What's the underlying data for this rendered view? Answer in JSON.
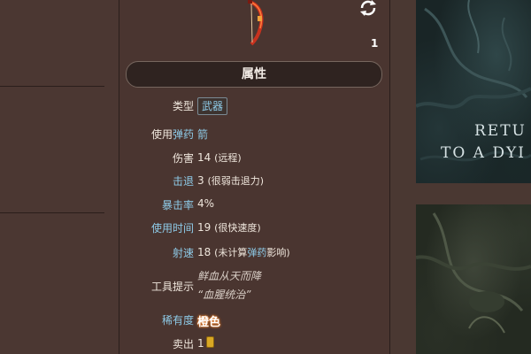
{
  "item": {
    "stack_count": "1",
    "section_title": "属性"
  },
  "stats": {
    "type_label": "类型",
    "type_value": "武器",
    "ammo_label_a": "使用",
    "ammo_label_b": "弹药",
    "ammo_value": "箭",
    "damage_label": "伤害",
    "damage_value": "14",
    "damage_note": "(远程)",
    "knockback_label": "击退",
    "knockback_value": "3",
    "knockback_note": "(很弱击退力)",
    "crit_label": "暴击率",
    "crit_value": "4%",
    "usetime_label": "使用时间",
    "usetime_value": "19",
    "usetime_note": "(很快速度)",
    "velocity_label": "射速",
    "velocity_value": "18",
    "velocity_note_a": "(未计算",
    "velocity_note_link": "弹药",
    "velocity_note_b": "影响)",
    "tooltip_label": "工具提示",
    "tooltip_line1": "鲜血从天而降",
    "tooltip_line2": "“血腥统治”",
    "rarity_label": "稀有度",
    "rarity_value": "橙色",
    "sell_label": "卖出",
    "sell_value": "1"
  },
  "art": {
    "line1": "RETU",
    "line2": "TO A DYI"
  },
  "colors": {
    "link": "#8ecbe8",
    "panel": "#4a3530",
    "header_bg": "#2f2320",
    "rarity_glow": "#e07a2a"
  },
  "icons": {
    "refresh": "refresh-icon",
    "coin": "gold-coin-icon",
    "sprite": "bow-sprite"
  }
}
